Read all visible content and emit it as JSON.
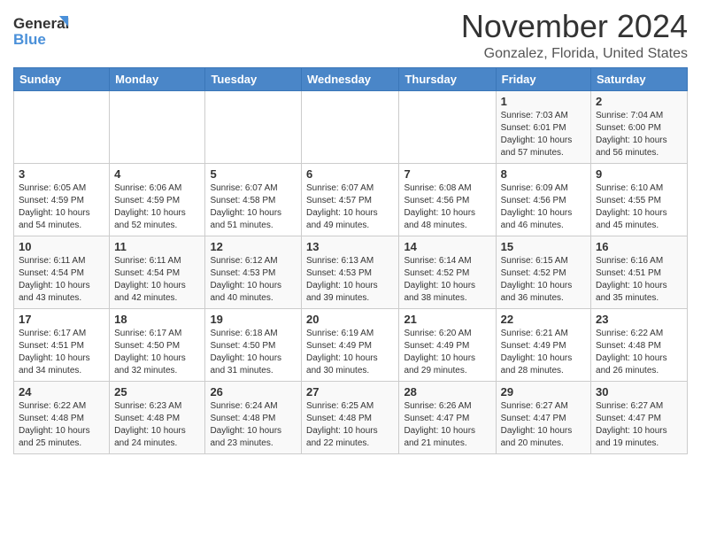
{
  "header": {
    "logo_line1": "General",
    "logo_line2": "Blue",
    "month_title": "November 2024",
    "location": "Gonzalez, Florida, United States"
  },
  "weekdays": [
    "Sunday",
    "Monday",
    "Tuesday",
    "Wednesday",
    "Thursday",
    "Friday",
    "Saturday"
  ],
  "weeks": [
    [
      {
        "day": "",
        "info": ""
      },
      {
        "day": "",
        "info": ""
      },
      {
        "day": "",
        "info": ""
      },
      {
        "day": "",
        "info": ""
      },
      {
        "day": "",
        "info": ""
      },
      {
        "day": "1",
        "info": "Sunrise: 7:03 AM\nSunset: 6:01 PM\nDaylight: 10 hours\nand 57 minutes."
      },
      {
        "day": "2",
        "info": "Sunrise: 7:04 AM\nSunset: 6:00 PM\nDaylight: 10 hours\nand 56 minutes."
      }
    ],
    [
      {
        "day": "3",
        "info": "Sunrise: 6:05 AM\nSunset: 4:59 PM\nDaylight: 10 hours\nand 54 minutes."
      },
      {
        "day": "4",
        "info": "Sunrise: 6:06 AM\nSunset: 4:59 PM\nDaylight: 10 hours\nand 52 minutes."
      },
      {
        "day": "5",
        "info": "Sunrise: 6:07 AM\nSunset: 4:58 PM\nDaylight: 10 hours\nand 51 minutes."
      },
      {
        "day": "6",
        "info": "Sunrise: 6:07 AM\nSunset: 4:57 PM\nDaylight: 10 hours\nand 49 minutes."
      },
      {
        "day": "7",
        "info": "Sunrise: 6:08 AM\nSunset: 4:56 PM\nDaylight: 10 hours\nand 48 minutes."
      },
      {
        "day": "8",
        "info": "Sunrise: 6:09 AM\nSunset: 4:56 PM\nDaylight: 10 hours\nand 46 minutes."
      },
      {
        "day": "9",
        "info": "Sunrise: 6:10 AM\nSunset: 4:55 PM\nDaylight: 10 hours\nand 45 minutes."
      }
    ],
    [
      {
        "day": "10",
        "info": "Sunrise: 6:11 AM\nSunset: 4:54 PM\nDaylight: 10 hours\nand 43 minutes."
      },
      {
        "day": "11",
        "info": "Sunrise: 6:11 AM\nSunset: 4:54 PM\nDaylight: 10 hours\nand 42 minutes."
      },
      {
        "day": "12",
        "info": "Sunrise: 6:12 AM\nSunset: 4:53 PM\nDaylight: 10 hours\nand 40 minutes."
      },
      {
        "day": "13",
        "info": "Sunrise: 6:13 AM\nSunset: 4:53 PM\nDaylight: 10 hours\nand 39 minutes."
      },
      {
        "day": "14",
        "info": "Sunrise: 6:14 AM\nSunset: 4:52 PM\nDaylight: 10 hours\nand 38 minutes."
      },
      {
        "day": "15",
        "info": "Sunrise: 6:15 AM\nSunset: 4:52 PM\nDaylight: 10 hours\nand 36 minutes."
      },
      {
        "day": "16",
        "info": "Sunrise: 6:16 AM\nSunset: 4:51 PM\nDaylight: 10 hours\nand 35 minutes."
      }
    ],
    [
      {
        "day": "17",
        "info": "Sunrise: 6:17 AM\nSunset: 4:51 PM\nDaylight: 10 hours\nand 34 minutes."
      },
      {
        "day": "18",
        "info": "Sunrise: 6:17 AM\nSunset: 4:50 PM\nDaylight: 10 hours\nand 32 minutes."
      },
      {
        "day": "19",
        "info": "Sunrise: 6:18 AM\nSunset: 4:50 PM\nDaylight: 10 hours\nand 31 minutes."
      },
      {
        "day": "20",
        "info": "Sunrise: 6:19 AM\nSunset: 4:49 PM\nDaylight: 10 hours\nand 30 minutes."
      },
      {
        "day": "21",
        "info": "Sunrise: 6:20 AM\nSunset: 4:49 PM\nDaylight: 10 hours\nand 29 minutes."
      },
      {
        "day": "22",
        "info": "Sunrise: 6:21 AM\nSunset: 4:49 PM\nDaylight: 10 hours\nand 28 minutes."
      },
      {
        "day": "23",
        "info": "Sunrise: 6:22 AM\nSunset: 4:48 PM\nDaylight: 10 hours\nand 26 minutes."
      }
    ],
    [
      {
        "day": "24",
        "info": "Sunrise: 6:22 AM\nSunset: 4:48 PM\nDaylight: 10 hours\nand 25 minutes."
      },
      {
        "day": "25",
        "info": "Sunrise: 6:23 AM\nSunset: 4:48 PM\nDaylight: 10 hours\nand 24 minutes."
      },
      {
        "day": "26",
        "info": "Sunrise: 6:24 AM\nSunset: 4:48 PM\nDaylight: 10 hours\nand 23 minutes."
      },
      {
        "day": "27",
        "info": "Sunrise: 6:25 AM\nSunset: 4:48 PM\nDaylight: 10 hours\nand 22 minutes."
      },
      {
        "day": "28",
        "info": "Sunrise: 6:26 AM\nSunset: 4:47 PM\nDaylight: 10 hours\nand 21 minutes."
      },
      {
        "day": "29",
        "info": "Sunrise: 6:27 AM\nSunset: 4:47 PM\nDaylight: 10 hours\nand 20 minutes."
      },
      {
        "day": "30",
        "info": "Sunrise: 6:27 AM\nSunset: 4:47 PM\nDaylight: 10 hours\nand 19 minutes."
      }
    ]
  ]
}
